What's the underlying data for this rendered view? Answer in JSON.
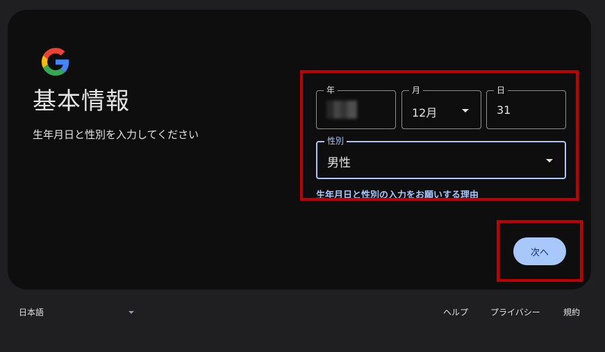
{
  "card": {
    "title": "基本情報",
    "subtitle": "生年月日と性別を入力してください"
  },
  "form": {
    "year": {
      "label": "年",
      "value": ""
    },
    "month": {
      "label": "月",
      "value": "12月"
    },
    "day": {
      "label": "日",
      "value": "31"
    },
    "gender": {
      "label": "性別",
      "value": "男性"
    },
    "reason_link": "生年月日と性別の入力をお願いする理由"
  },
  "actions": {
    "next_label": "次へ"
  },
  "footer": {
    "language": "日本語",
    "help": "ヘルプ",
    "privacy": "プライバシー",
    "terms": "規約"
  },
  "colors": {
    "page_bg": "#1f1f21",
    "card_bg": "#0e0e0f",
    "accent": "#a8c7fa",
    "highlight": "#c00000"
  },
  "icons": {
    "logo": "google-g-icon",
    "month_dropdown": "caret-down-icon",
    "gender_dropdown": "caret-down-icon",
    "language_dropdown": "caret-down-icon"
  }
}
